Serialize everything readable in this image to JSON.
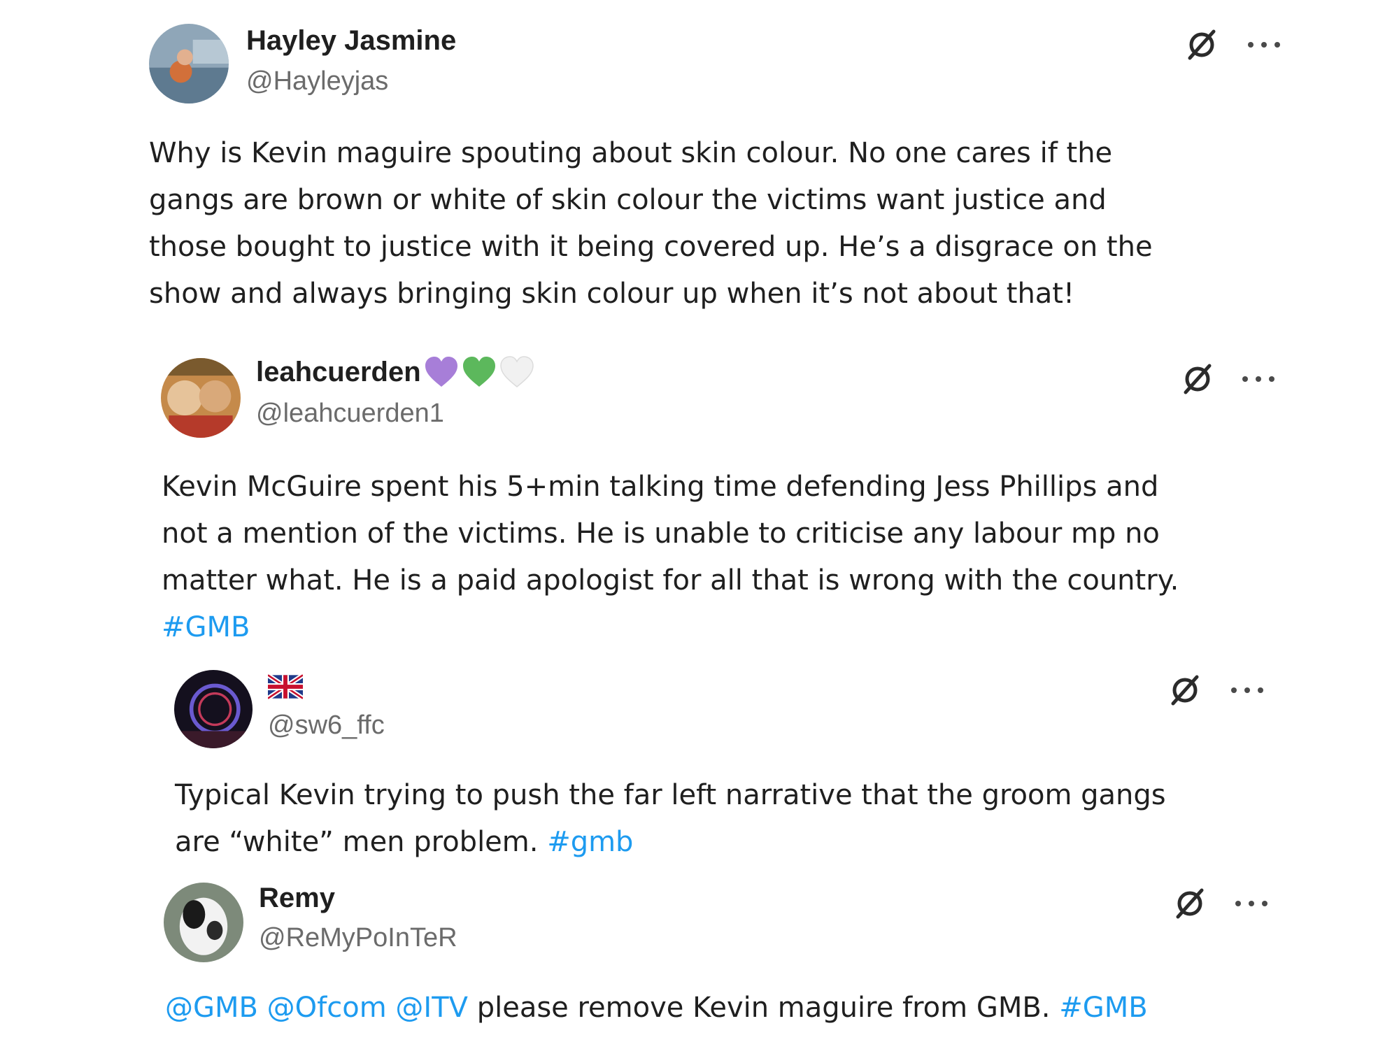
{
  "posts": [
    {
      "name": "Hayley Jasmine",
      "handle": "@Hayleyjas",
      "lines": [
        "Why is Kevin maguire spouting about skin colour. No one cares if the",
        "gangs are brown or white of skin colour the victims want justice and",
        "those bought to justice with it being covered up. He’s a disgrace on the",
        "show and always bringing skin colour up when it’s not about that!"
      ]
    },
    {
      "name": "leahcuerden",
      "name_emojis": [
        "purple-heart",
        "green-heart",
        "white-heart"
      ],
      "handle": "@leahcuerden1",
      "lines": [
        "Kevin McGuire spent his 5+min talking time defending Jess Phillips and",
        "not a mention of the victims. He is unable to criticise any labour mp no",
        "matter what. He is a paid apologist for all that is wrong with the country."
      ],
      "hashtag": "#GMB"
    },
    {
      "name_icon": "uk-flag",
      "handle": "@sw6_ffc",
      "line1": "Typical Kevin trying to push the far left narrative that the groom gangs",
      "line2_text": "are “white” men problem. ",
      "hashtag": "#gmb"
    },
    {
      "name": "Remy",
      "handle": "@ReMyPoInTeR",
      "mentions": [
        "@GMB",
        "@Ofcom",
        "@ITV"
      ],
      "text": " please remove Kevin maguire from GMB. ",
      "hashtag": "#GMB"
    }
  ],
  "icons": {
    "grok": "grok-icon",
    "more": "more-icon"
  },
  "colors": {
    "link": "#1d9bf0",
    "text": "#1f1f1f",
    "handle": "#6b6b6b"
  }
}
